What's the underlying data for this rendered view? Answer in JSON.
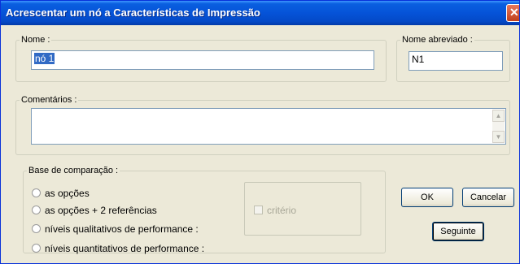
{
  "window": {
    "title": "Acrescentar um nó a Características de Impressão"
  },
  "nome": {
    "label": "Nome :",
    "value": "nó 1"
  },
  "nome_abreviado": {
    "label": "Nome abreviado :",
    "value": "N1"
  },
  "comentarios": {
    "label": "Comentários :",
    "value": ""
  },
  "base": {
    "label": "Base de comparação :",
    "options": [
      "as opções",
      "as opções + 2 referências",
      "níveis qualitativos de performance :",
      "níveis quantitativos de performance :"
    ],
    "criterio_label": "critério"
  },
  "buttons": {
    "ok": "OK",
    "cancelar": "Cancelar",
    "seguinte": "Seguinte"
  }
}
